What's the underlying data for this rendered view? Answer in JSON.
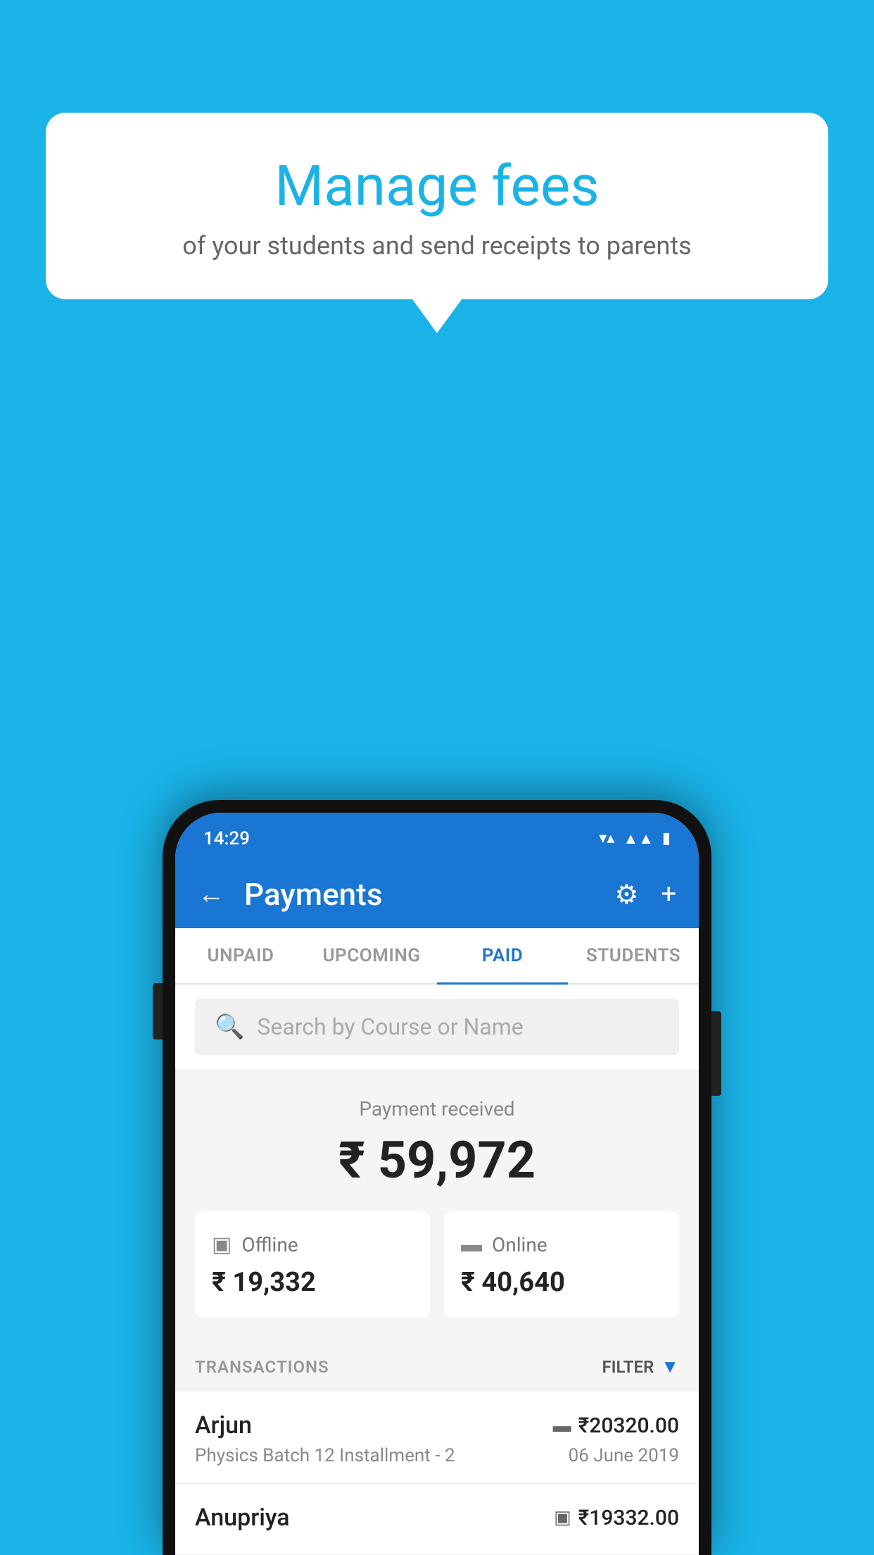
{
  "background_color": "#1ab3e8",
  "bubble": {
    "title": "Manage fees",
    "subtitle": "of your students and send receipts to parents"
  },
  "status_bar": {
    "time": "14:29",
    "wifi": "▼",
    "signal": "◀",
    "battery": "▮"
  },
  "app_bar": {
    "title": "Payments",
    "back_label": "←",
    "gear_label": "⚙",
    "plus_label": "+"
  },
  "tabs": [
    {
      "label": "UNPAID",
      "active": false
    },
    {
      "label": "UPCOMING",
      "active": false
    },
    {
      "label": "PAID",
      "active": true
    },
    {
      "label": "STUDENTS",
      "active": false
    }
  ],
  "search": {
    "placeholder": "Search by Course or Name"
  },
  "payment_received": {
    "label": "Payment received",
    "amount": "₹ 59,972"
  },
  "offline_card": {
    "icon": "▣",
    "label": "Offline",
    "amount": "₹ 19,332"
  },
  "online_card": {
    "icon": "▬",
    "label": "Online",
    "amount": "₹ 40,640"
  },
  "transactions_header": {
    "label": "TRANSACTIONS",
    "filter_label": "FILTER"
  },
  "transactions": [
    {
      "name": "Arjun",
      "amount": "₹20320.00",
      "mode_icon": "▬",
      "course": "Physics Batch 12 Installment - 2",
      "date": "06 June 2019"
    },
    {
      "name": "Anupriya",
      "amount": "₹19332.00",
      "mode_icon": "▣",
      "course": "",
      "date": ""
    }
  ]
}
